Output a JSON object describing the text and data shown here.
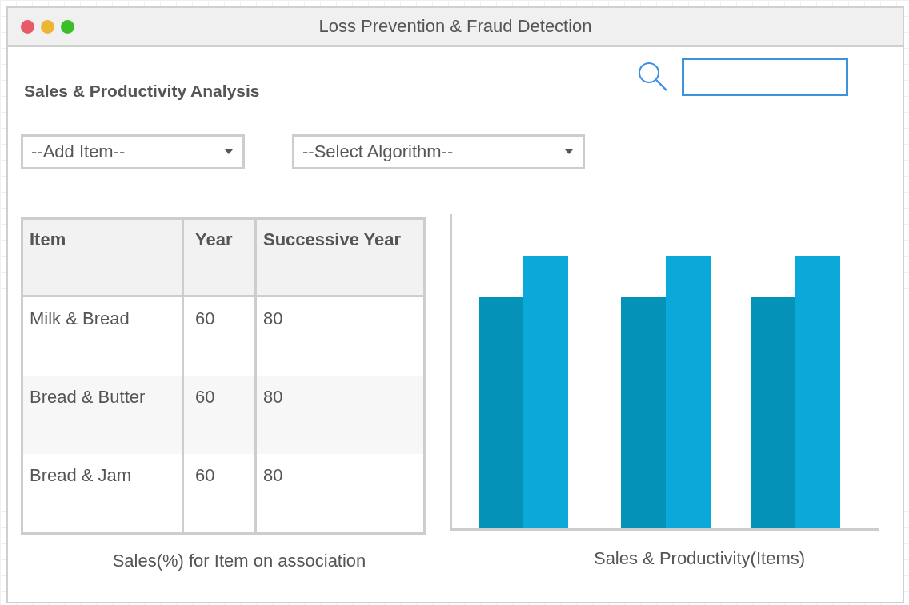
{
  "window": {
    "title": "Loss Prevention & Fraud Detection"
  },
  "heading": "Sales & Productivity Analysis",
  "dropdowns": [
    {
      "value": "--Add Item--"
    },
    {
      "value": "--Select Algorithm--"
    }
  ],
  "table": {
    "columns": [
      "Item",
      "Year",
      "Successive Year"
    ],
    "rows": [
      [
        "Milk & Bread",
        "60",
        "80"
      ],
      [
        "Bread & Butter",
        "60",
        "80"
      ],
      [
        "Bread & Jam",
        "60",
        "80"
      ]
    ],
    "caption": "Sales(%) for Item on association"
  },
  "chart": {
    "kind": "picture",
    "caption": "Sales & Productivity(Items)"
  }
}
